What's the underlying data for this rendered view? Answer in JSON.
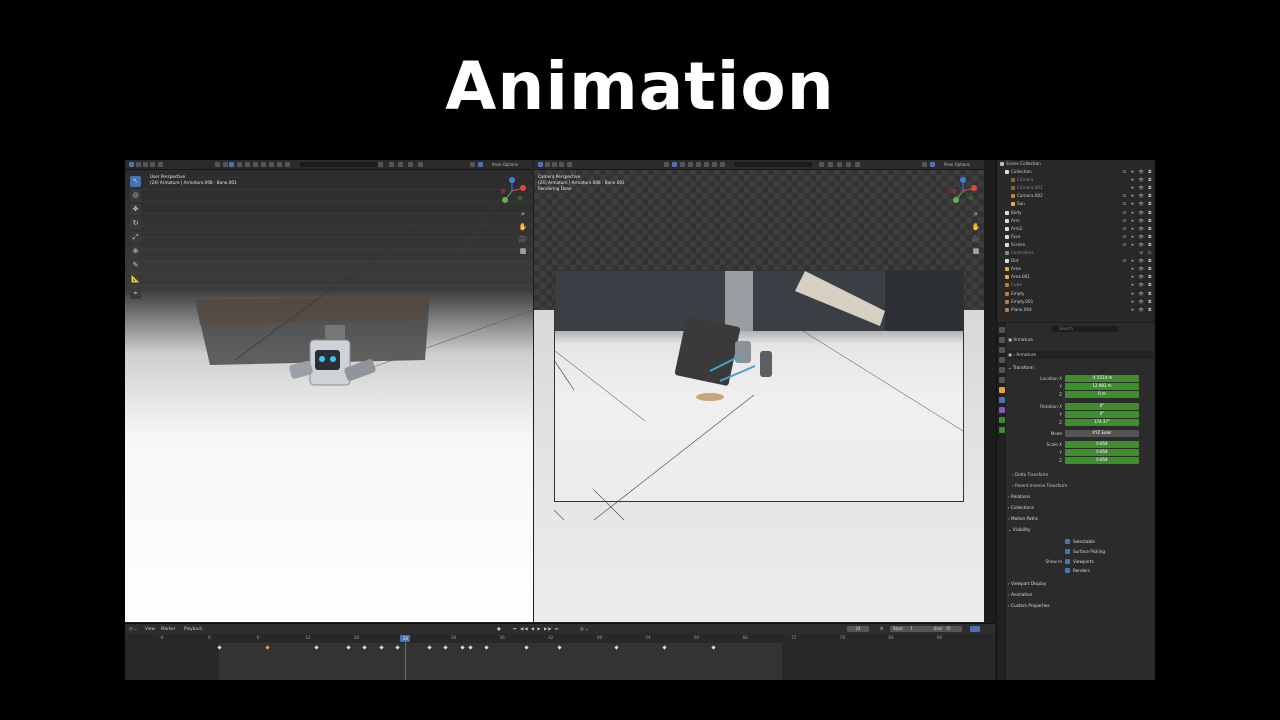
{
  "slide": {
    "title": "Animation"
  },
  "viewport_left": {
    "perspective": "User Perspective",
    "context": "(24) Armature | Armature.008 : Bone.001",
    "mode_button": "Pose Options"
  },
  "viewport_right": {
    "perspective": "Camera Perspective",
    "context": "(24) Armature | Armature.008 : Bone.001",
    "status": "Rendering Done",
    "mode_button": "Pose Options"
  },
  "outliner": {
    "root": "Scene Collection",
    "items": [
      {
        "label": "Collection"
      },
      {
        "label": "Camera"
      },
      {
        "label": "Camera.001"
      },
      {
        "label": "Camera.002"
      },
      {
        "label": "Sun"
      },
      {
        "label": "Body"
      },
      {
        "label": "Arm"
      },
      {
        "label": "Arm2"
      },
      {
        "label": "Face"
      },
      {
        "label": "Screen"
      },
      {
        "label": "Controllers"
      },
      {
        "label": "Dot"
      },
      {
        "label": "Area"
      },
      {
        "label": "Area.001"
      },
      {
        "label": "Cube"
      },
      {
        "label": "Empty"
      },
      {
        "label": "Empty.001"
      },
      {
        "label": "Plane.004"
      }
    ]
  },
  "properties": {
    "search_placeholder": "Search",
    "object_name": "Armature",
    "data_name": "Armature",
    "transform_label": "Transform",
    "location": {
      "label": "Location X",
      "x": "-4.5514 m",
      "y": "12.983 m",
      "z": "0 m"
    },
    "rotation": {
      "label": "Rotation X",
      "x": "0°",
      "y": "0°",
      "z": "174.37°"
    },
    "mode": {
      "label": "Mode",
      "value": "XYZ Euler"
    },
    "scale": {
      "label": "Scale X",
      "x": "0.854",
      "y": "0.854",
      "z": "0.854"
    },
    "axis_y": "Y",
    "axis_z": "Z",
    "delta_transform": "Delta Transform",
    "parent_inverse": "Parent Inverse Transform",
    "relations": "Relations",
    "collections": "Collections",
    "motion_paths": "Motion Paths",
    "visibility": "Visibility",
    "selectable": "Selectable",
    "surface_picking": "Surface Picking",
    "show_in": "Show In",
    "viewports": "Viewports",
    "renders": "Renders",
    "viewport_display": "Viewport Display",
    "animation": "Animation",
    "custom_properties": "Custom Properties"
  },
  "timeline": {
    "menu": [
      "View",
      "Marker",
      "Playback"
    ],
    "current_frame": "24",
    "start_label": "Start",
    "start_value": "1",
    "end_label": "End",
    "end_value": "70",
    "frame_ticks": [
      "-6",
      "0",
      "6",
      "12",
      "18",
      "24",
      "30",
      "36",
      "42",
      "48",
      "54",
      "60",
      "66",
      "72",
      "78",
      "84",
      "90"
    ]
  },
  "keyframes": [
    {
      "frame": 1
    },
    {
      "frame": 13
    },
    {
      "frame": 17
    },
    {
      "frame": 19
    },
    {
      "frame": 21
    },
    {
      "frame": 23
    },
    {
      "frame": 27
    },
    {
      "frame": 29
    },
    {
      "frame": 31
    },
    {
      "frame": 32
    },
    {
      "frame": 34
    },
    {
      "frame": 39
    },
    {
      "frame": 43
    },
    {
      "frame": 50
    },
    {
      "frame": 56
    },
    {
      "frame": 62
    }
  ],
  "selected_keyframe": {
    "frame": 7
  },
  "colors": {
    "accent": "#4772b3",
    "field_green": "#3e8e2e"
  }
}
